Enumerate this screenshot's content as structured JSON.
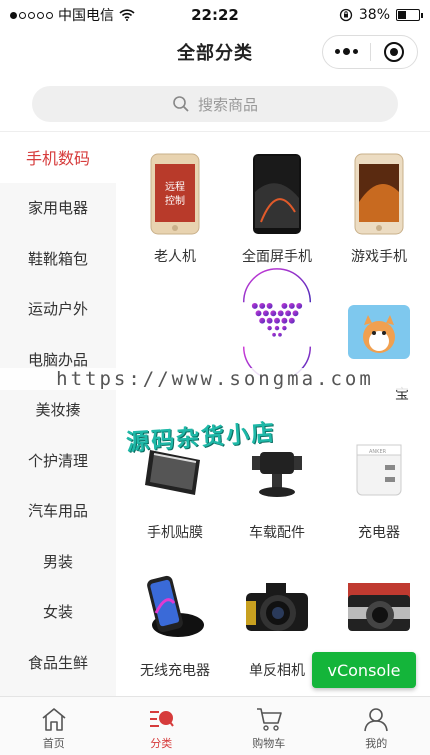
{
  "status": {
    "carrier": "中国电信",
    "time": "22:22",
    "battery": "38%",
    "battery_level": 0.38
  },
  "nav": {
    "title": "全部分类"
  },
  "search": {
    "placeholder": "搜索商品"
  },
  "sidebar": {
    "items": [
      {
        "label": "手机数码",
        "active": true
      },
      {
        "label": "家用电器"
      },
      {
        "label": "鞋靴箱包"
      },
      {
        "label": "运动户外"
      },
      {
        "label": "电脑办品"
      },
      {
        "label": "美妆揍"
      },
      {
        "label": "个护清理"
      },
      {
        "label": "汽车用品"
      },
      {
        "label": "男装"
      },
      {
        "label": "女装"
      },
      {
        "label": "食品生鲜"
      }
    ]
  },
  "products": [
    {
      "label": "老人机",
      "icon": "gold-phone"
    },
    {
      "label": "全面屏手机",
      "icon": "black-phone"
    },
    {
      "label": "游戏手机",
      "icon": "gold-phone-2"
    },
    {
      "label": "",
      "icon": "watermark-logo"
    },
    {
      "label": "",
      "icon": "hidden"
    },
    {
      "label": "宝",
      "icon": "power-bank"
    },
    {
      "label": "手机贴膜",
      "icon": "screen-film"
    },
    {
      "label": "车载配件",
      "icon": "car-mount"
    },
    {
      "label": "充电器",
      "icon": "charger"
    },
    {
      "label": "无线充电器",
      "icon": "wireless-charger"
    },
    {
      "label": "单反相机",
      "icon": "dslr-camera"
    },
    {
      "label": "",
      "icon": "mirrorless-camera"
    }
  ],
  "watermark": {
    "url": "https://www.songma.com",
    "shop": "源码杂货小店"
  },
  "vconsole": {
    "label": "vConsole"
  },
  "tabs": [
    {
      "label": "首页",
      "icon": "home-icon"
    },
    {
      "label": "分类",
      "icon": "category-icon",
      "active": true
    },
    {
      "label": "购物车",
      "icon": "cart-icon"
    },
    {
      "label": "我的",
      "icon": "user-icon"
    }
  ],
  "colors": {
    "accent": "#d63b3b",
    "vconsole": "#14b53a",
    "watermark_text": "#1fb9a8"
  }
}
